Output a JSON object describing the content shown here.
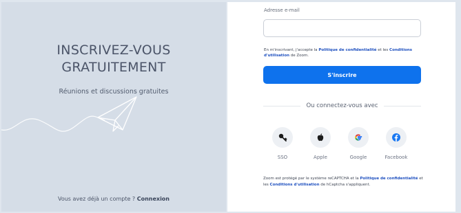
{
  "left": {
    "title_line1": "INSCRIVEZ-VOUS",
    "title_line2": "GRATUITEMENT",
    "subtitle": "Réunions et discussions gratuites",
    "footer_text": "Vous avez déjà un compte ? ",
    "footer_link": "Connexion"
  },
  "form": {
    "email_label": "Adresse e-mail",
    "email_value": "",
    "terms_prefix": "En m'inscrivant, j'accepte la ",
    "terms_privacy": "Politique de confidentialité",
    "terms_and": " et les ",
    "terms_conditions": "Conditions d'utilisation",
    "terms_suffix": " de Zoom.",
    "submit_label": "S'inscrire",
    "divider_text": "Ou connectez-vous avec"
  },
  "social": [
    {
      "label": "SSO",
      "icon": "key-icon"
    },
    {
      "label": "Apple",
      "icon": "apple-icon"
    },
    {
      "label": "Google",
      "icon": "google-icon"
    },
    {
      "label": "Facebook",
      "icon": "facebook-icon"
    }
  ],
  "captcha": {
    "prefix": "Zoom est protégé par le système reCAPTCHA et la ",
    "privacy": "Politique de confidentialité",
    "and": " et les ",
    "conditions": "Conditions d'utilisation",
    "suffix": " de hCaptcha s'appliquent."
  },
  "colors": {
    "brand": "#0e72ed",
    "left_panel": "#d5dde7",
    "link": "#1d4fbf"
  }
}
